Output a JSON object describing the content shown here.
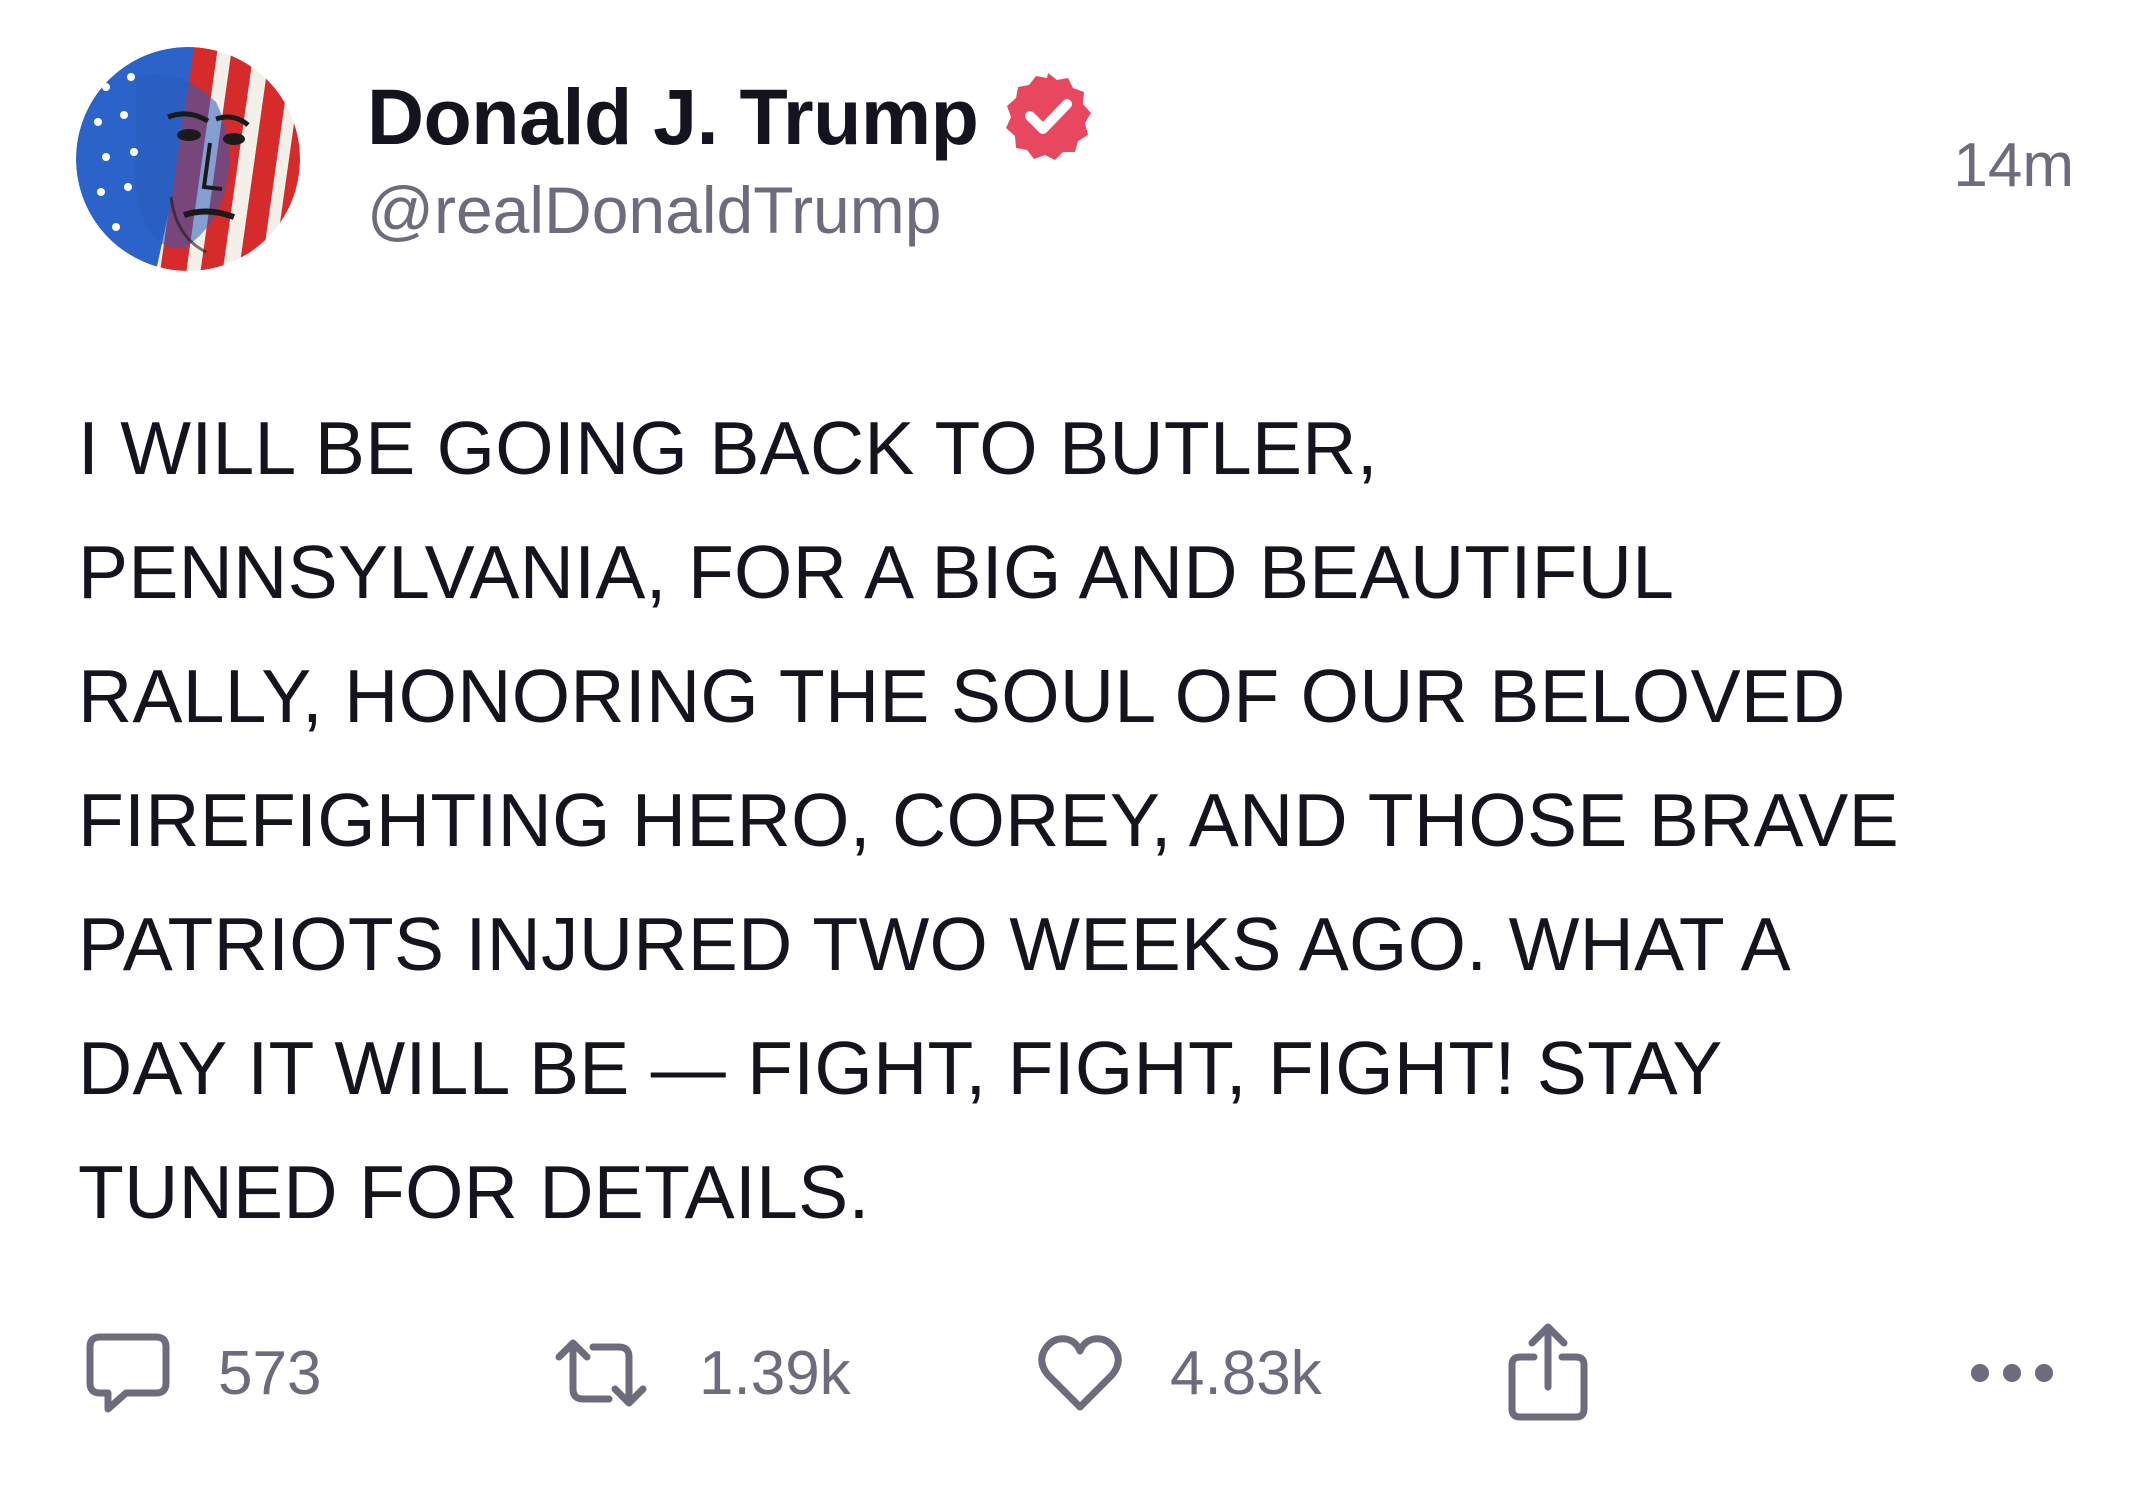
{
  "post": {
    "author": {
      "display_name": "Donald J. Trump",
      "handle": "@realDonaldTrump",
      "verified_icon": "verified-badge-icon",
      "avatar_icon": "avatar-flag-face-image"
    },
    "timestamp": "14m",
    "body_lines": [
      "I WILL BE GOING BACK TO BUTLER,",
      "PENNSYLVANIA, FOR A BIG AND BEAUTIFUL",
      "RALLY, HONORING THE SOUL OF OUR BELOVED",
      "FIREFIGHTING HERO, COREY, AND THOSE BRAVE",
      "PATRIOTS INJURED TWO WEEKS AGO. WHAT A",
      "DAY IT WILL BE — FIGHT, FIGHT, FIGHT! STAY",
      "TUNED FOR DETAILS."
    ],
    "actions": {
      "reply": {
        "icon": "reply-icon",
        "count": "573"
      },
      "repost": {
        "icon": "repost-icon",
        "count": "1.39k"
      },
      "like": {
        "icon": "heart-icon",
        "count": "4.83k"
      },
      "share": {
        "icon": "share-icon"
      },
      "more": {
        "icon": "more-icon"
      }
    }
  },
  "colors": {
    "text_primary": "#14141e",
    "text_secondary": "#6d6c7c",
    "verified_badge": "#e8485f",
    "background": "#ffffff"
  }
}
